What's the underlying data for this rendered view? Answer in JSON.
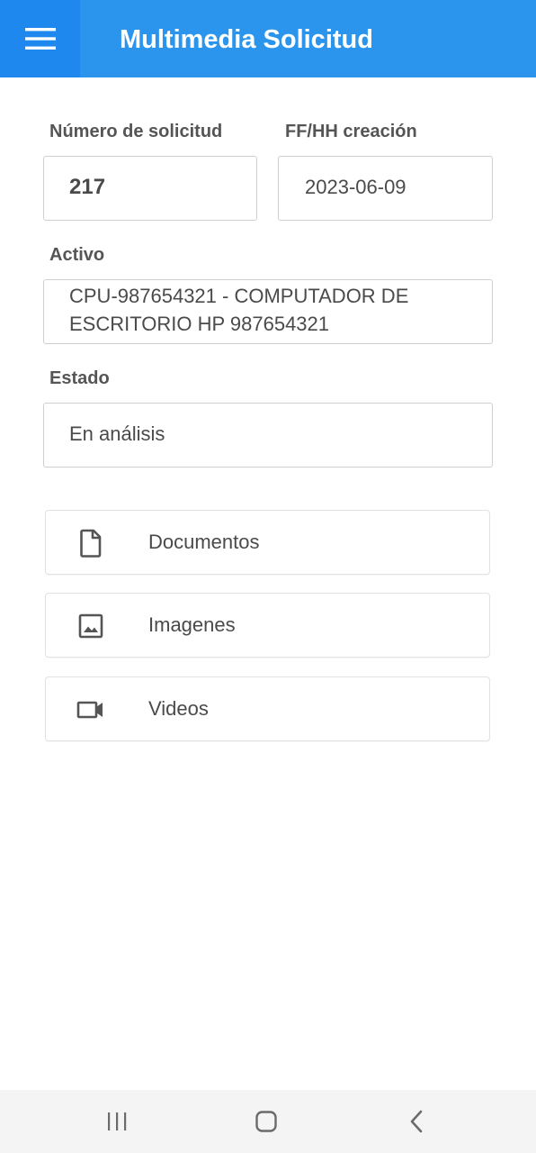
{
  "app_bar": {
    "title": "Multimedia Solicitud",
    "menu_icon": "hamburger-menu-icon",
    "background": "#2b95ee"
  },
  "form": {
    "numero_label": "Número de solicitud",
    "numero_value": "217",
    "fecha_label": "FF/HH creación",
    "fecha_value": "2023-06-09",
    "activo_label": "Activo",
    "activo_line1": "CPU-987654321 - COMPUTADOR DE",
    "activo_line2": "ESCRITORIO HP 987654321",
    "estado_label": "Estado",
    "estado_value": "En análisis"
  },
  "media_options": [
    {
      "label": "Documentos",
      "icon": "document-icon"
    },
    {
      "label": "Imagenes",
      "icon": "image-icon"
    },
    {
      "label": "Videos",
      "icon": "video-camera-icon"
    }
  ],
  "system_nav": {
    "recents_icon": "recents-icon",
    "home_icon": "home-icon",
    "back_icon": "back-icon"
  }
}
